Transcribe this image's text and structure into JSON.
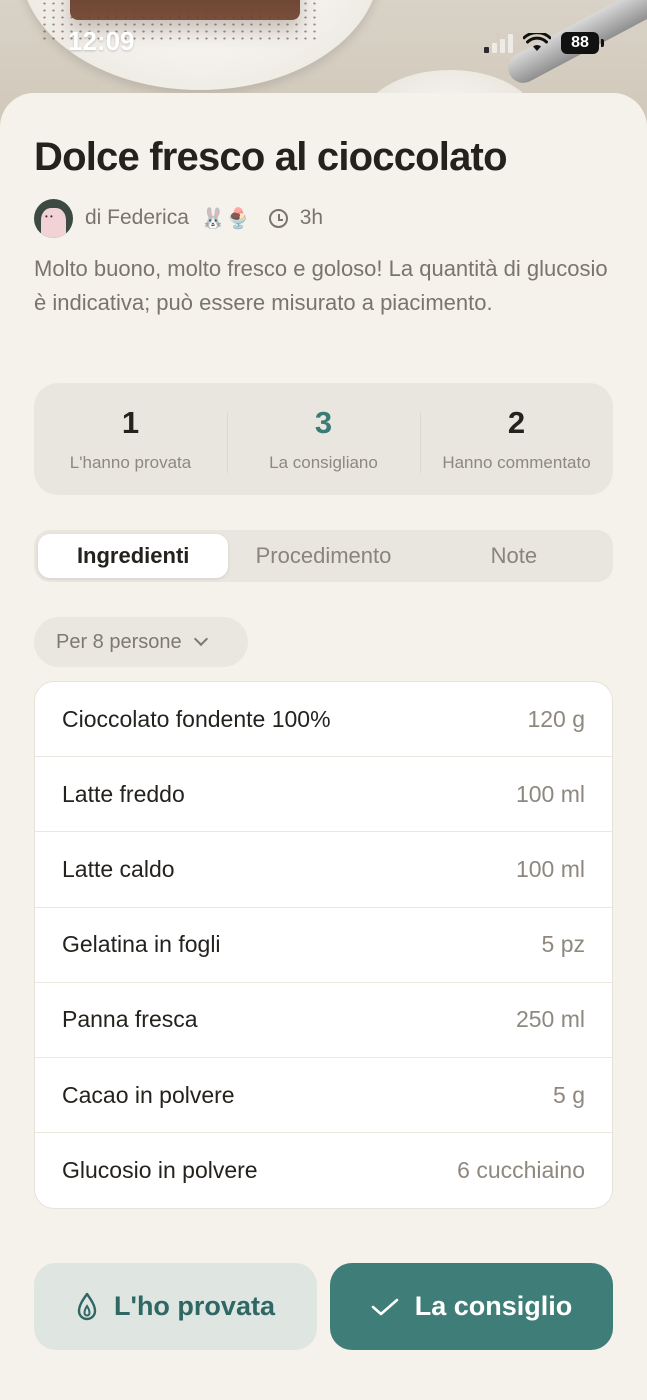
{
  "status_bar": {
    "time": "12:09",
    "battery": "88"
  },
  "recipe": {
    "title": "Dolce fresco al cioccolato",
    "author": "di Federica",
    "author_emojis": "🐰🍨",
    "duration": "3h",
    "description": "Molto buono, molto fresco e goloso! La quantità di glucosio è indicativa; può essere misurato a piacimento."
  },
  "stats": [
    {
      "value": "1",
      "label": "L'hanno provata"
    },
    {
      "value": "3",
      "label": "La consigliano"
    },
    {
      "value": "2",
      "label": "Hanno commentato"
    }
  ],
  "tabs": [
    {
      "label": "Ingredienti",
      "active": true
    },
    {
      "label": "Procedimento",
      "active": false
    },
    {
      "label": "Note",
      "active": false
    }
  ],
  "servings": {
    "label": "Per 8 persone"
  },
  "ingredients": [
    {
      "name": "Cioccolato fondente 100%",
      "qty": "120 g"
    },
    {
      "name": "Latte freddo",
      "qty": "100 ml"
    },
    {
      "name": "Latte caldo",
      "qty": "100 ml"
    },
    {
      "name": "Gelatina in fogli",
      "qty": "5 pz"
    },
    {
      "name": "Panna fresca",
      "qty": "250 ml"
    },
    {
      "name": "Cacao in polvere",
      "qty": "5 g"
    },
    {
      "name": "Glucosio in polvere",
      "qty": "6 cucchiaino"
    }
  ],
  "actions": {
    "tried_label": "L'ho provata",
    "recommend_label": "La consiglio"
  },
  "colors": {
    "accent": "#3f7d78",
    "background": "#f5f2ec"
  }
}
